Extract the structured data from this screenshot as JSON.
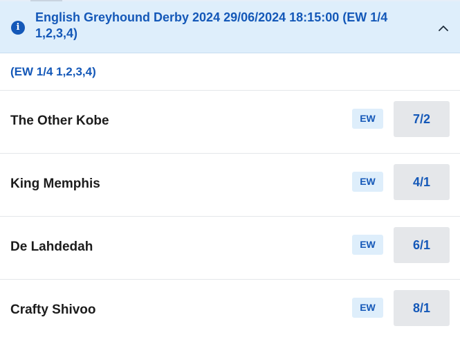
{
  "market": {
    "title": "English Greyhound Derby 2024 29/06/2024 18:15:00 (EW 1/4 1,2,3,4)",
    "info_icon": "info-icon",
    "collapse_icon": "chevron-up-icon",
    "terms": "(EW 1/4 1,2,3,4)"
  },
  "runners": [
    {
      "name": "The Other Kobe",
      "ew": "EW",
      "odds": "7/2"
    },
    {
      "name": "King Memphis",
      "ew": "EW",
      "odds": "4/1"
    },
    {
      "name": "De Lahdedah",
      "ew": "EW",
      "odds": "6/1"
    },
    {
      "name": "Crafty Shivoo",
      "ew": "EW",
      "odds": "8/1"
    }
  ],
  "colors": {
    "accent": "#1458b8",
    "header_bg": "#deeefb",
    "odds_bg": "#e5e7ea"
  }
}
